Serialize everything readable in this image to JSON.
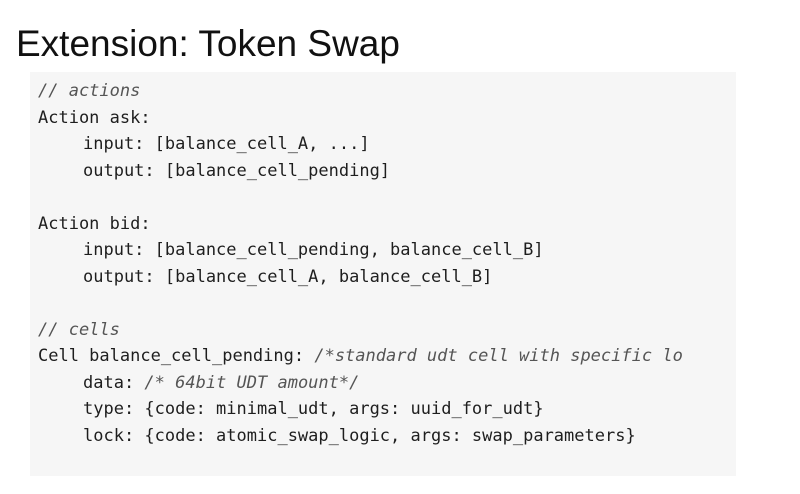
{
  "title": "Extension: Token Swap",
  "code": {
    "actions_comment": "// actions",
    "ask_header": "Action ask:",
    "ask_input": "input: [balance_cell_A, ...]",
    "ask_output": "output: [balance_cell_pending]",
    "bid_header": "Action bid:",
    "bid_input": "input: [balance_cell_pending, balance_cell_B]",
    "bid_output": "output: [balance_cell_A, balance_cell_B]",
    "cells_comment": "// cells",
    "cell_decl": "Cell balance_cell_pending: ",
    "cell_decl_comment": "/*standard udt cell with specific lo",
    "data_key": "data: ",
    "data_comment": "/* 64bit UDT amount*/",
    "type_line": "type: {code: minimal_udt, args: uuid_for_udt}",
    "lock_line": "lock: {code: atomic_swap_logic, args: swap_parameters}"
  }
}
